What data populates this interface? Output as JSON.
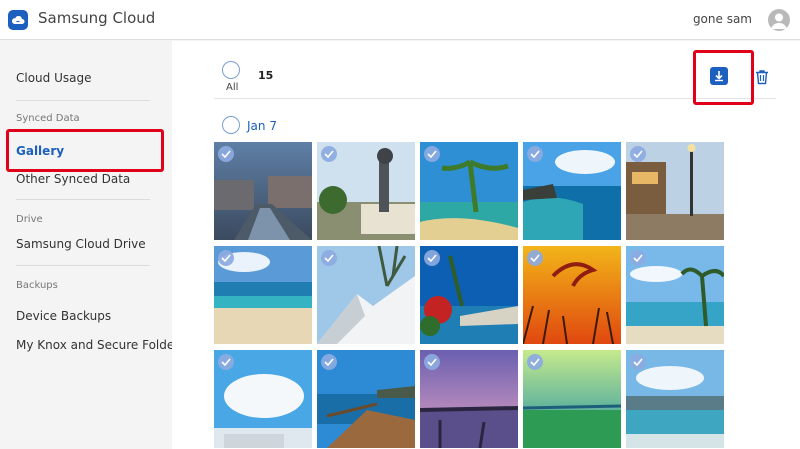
{
  "header": {
    "app_title": "Samsung Cloud",
    "user_name": "gone sam",
    "brand_color": "#1c5fbe"
  },
  "sidebar": {
    "cloud_usage": "Cloud Usage",
    "synced_data_header": "Synced Data",
    "gallery": "Gallery",
    "other_synced": "Other Synced Data",
    "drive_header": "Drive",
    "cloud_drive": "Samsung Cloud Drive",
    "backups_header": "Backups",
    "device_backups": "Device Backups",
    "knox": "My Knox and Secure Folder"
  },
  "toolbar": {
    "all_label": "All",
    "selected_count": "15",
    "download_icon": "download-icon",
    "trash_icon": "trash-icon"
  },
  "gallery": {
    "date_label": "Jan 7",
    "photos": [
      {
        "scene": "canal-town",
        "selected": true
      },
      {
        "scene": "stork-statue",
        "selected": true
      },
      {
        "scene": "palm-shore",
        "selected": true
      },
      {
        "scene": "blue-sea-rocks",
        "selected": true
      },
      {
        "scene": "night-street",
        "selected": true
      },
      {
        "scene": "tropical-beach",
        "selected": true
      },
      {
        "scene": "snowy-peak",
        "selected": true
      },
      {
        "scene": "flower-coast",
        "selected": true
      },
      {
        "scene": "sunset-birds",
        "selected": true
      },
      {
        "scene": "palm-beach-people",
        "selected": true
      },
      {
        "scene": "clouds-beach",
        "selected": true
      },
      {
        "scene": "boardwalk",
        "selected": true
      },
      {
        "scene": "purple-dusk",
        "selected": true
      },
      {
        "scene": "green-meadow",
        "selected": true
      },
      {
        "scene": "calm-bay",
        "selected": true
      }
    ]
  }
}
